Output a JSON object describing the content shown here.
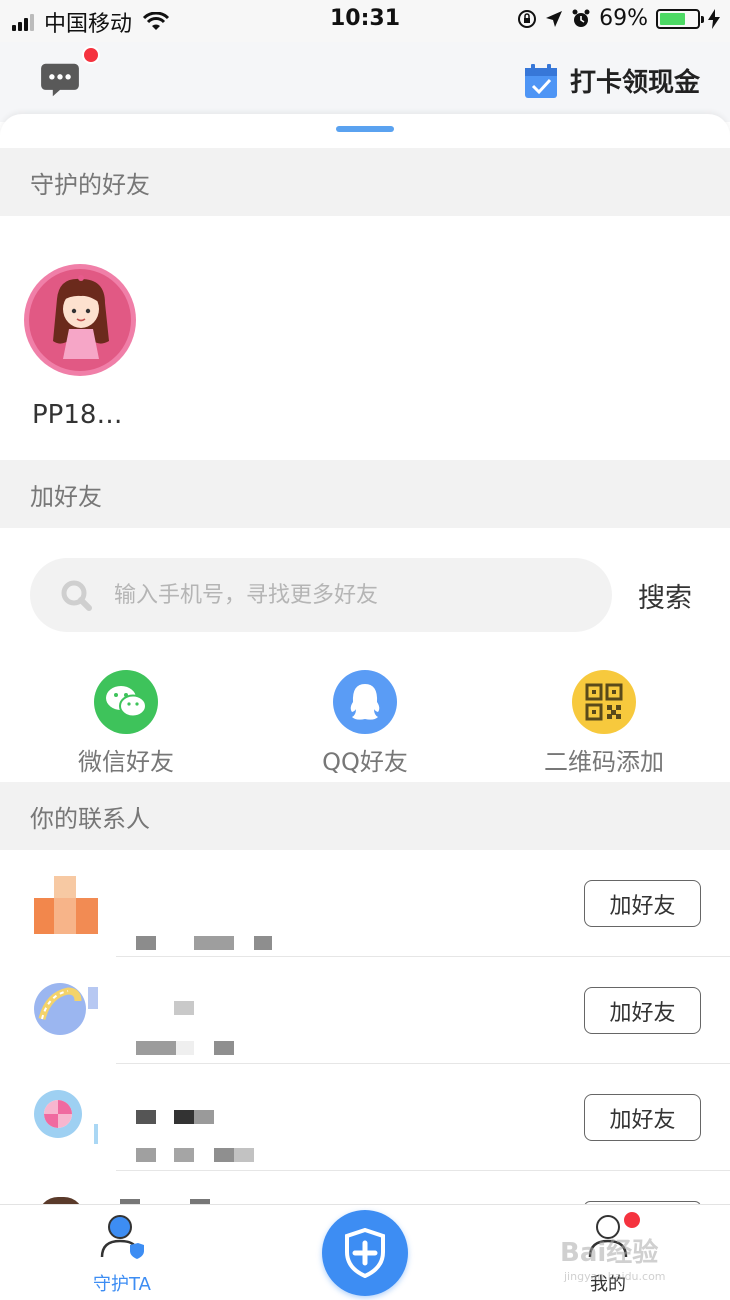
{
  "status_bar": {
    "carrier": "中国移动",
    "time": "10:31",
    "battery_percent": "69%",
    "battery_level": 0.69
  },
  "header": {
    "checkin_label": "打卡领现金",
    "accent_color": "#3d8df3",
    "badge_color": "#f5333f"
  },
  "sections": {
    "guarded_friends": "守护的好友",
    "add_friends": "加好友",
    "contacts": "你的联系人"
  },
  "guarded_friend": {
    "name": "PP18…"
  },
  "search": {
    "placeholder": "输入手机号，寻找更多好友",
    "button_label": "搜索"
  },
  "share_options": [
    {
      "label": "微信好友",
      "icon": "wechat-icon",
      "color": "#3ec35b"
    },
    {
      "label": "QQ好友",
      "icon": "qq-icon",
      "color": "#5a9cf5"
    },
    {
      "label": "二维码添加",
      "icon": "qrcode-icon",
      "color": "#f7c93d"
    }
  ],
  "contacts": [
    {
      "add_label": "加好友"
    },
    {
      "add_label": "加好友"
    },
    {
      "add_label": "加好友"
    }
  ],
  "tabbar": {
    "guard_label": "守护TA",
    "mine_label": "我的"
  },
  "watermark": {
    "text": "Bai经验",
    "sub": "jingyan.baidu.com"
  }
}
